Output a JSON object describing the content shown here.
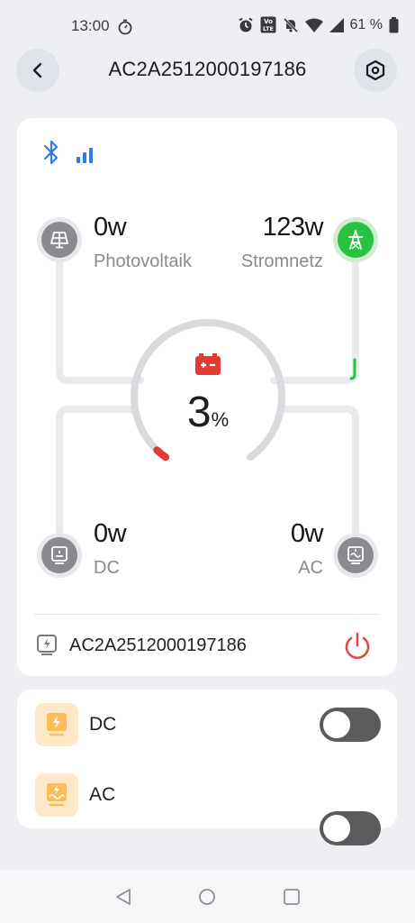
{
  "status_bar": {
    "time": "13:00",
    "battery": "61 %",
    "icons": [
      "stopwatch-icon",
      "alarm-icon",
      "volte-icon",
      "mute-icon",
      "wifi-icon",
      "signal-icon",
      "battery-icon"
    ]
  },
  "header": {
    "title": "AC2A2512000197186",
    "back_icon": "back-arrow-icon",
    "settings_icon": "hexagon-settings-icon"
  },
  "flow": {
    "pv": {
      "value": "0w",
      "label": "Photovoltaik"
    },
    "grid": {
      "value": "123w",
      "label": "Stromnetz"
    },
    "dc": {
      "value": "0w",
      "label": "DC"
    },
    "ac": {
      "value": "0w",
      "label": "AC"
    },
    "soc": {
      "value": "3",
      "unit": "%",
      "level": 0.03
    },
    "colors": {
      "grid_active": "#27c33f",
      "low_battery": "#e53935",
      "bluetooth": "#2f7ce8"
    }
  },
  "device": {
    "id": "AC2A2512000197186"
  },
  "outputs": [
    {
      "label": "DC",
      "enabled": false
    },
    {
      "label": "AC",
      "enabled": false
    }
  ],
  "navbar": {
    "icons": [
      "back-nav-icon",
      "home-nav-icon",
      "recents-nav-icon"
    ]
  }
}
